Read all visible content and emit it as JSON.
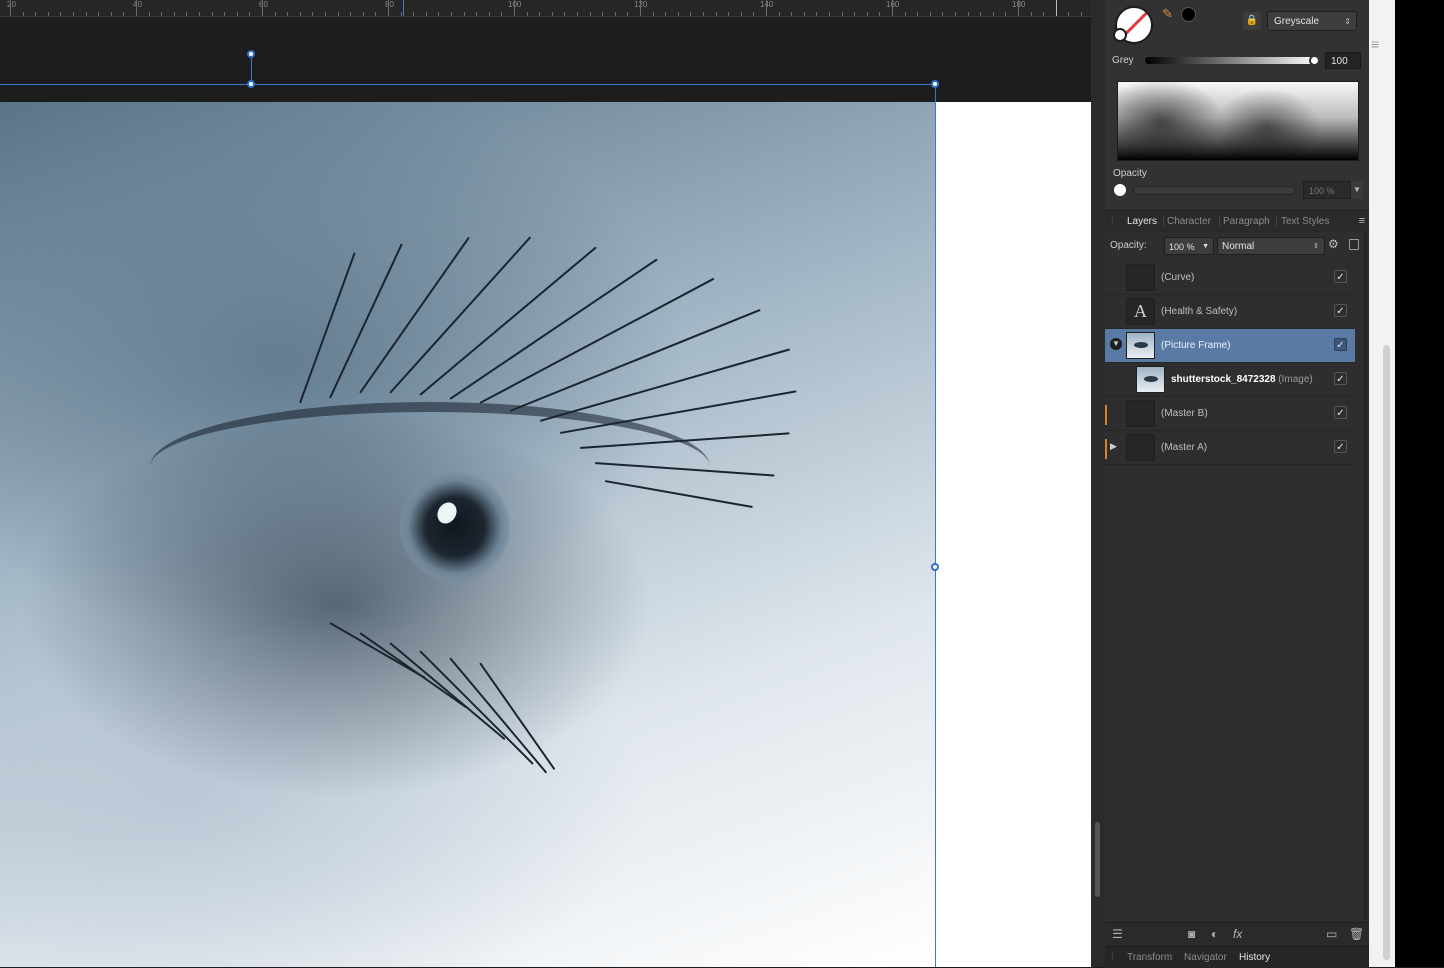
{
  "ruler": {
    "labels": [
      "20",
      "40",
      "60",
      "80",
      "100",
      "120",
      "140",
      "160",
      "180"
    ]
  },
  "color_panel": {
    "mode": "Greyscale",
    "grey_label": "Grey",
    "grey_value": "100",
    "opacity_label": "Opacity",
    "opacity_value": "100 %"
  },
  "tabs": {
    "layers": "Layers",
    "character": "Character",
    "paragraph": "Paragraph",
    "text_styles": "Text Styles"
  },
  "layer_options": {
    "opacity_label": "Opacity:",
    "opacity_value": "100 %",
    "blend_mode": "Normal"
  },
  "layers": [
    {
      "name": "(Curve)",
      "checked": true
    },
    {
      "name": "(Health & Safety)",
      "checked": true,
      "thumb_letter": "A"
    },
    {
      "name": "(Picture Frame)",
      "checked": true,
      "selected": true
    },
    {
      "name": "shutterstock_8472328",
      "suffix": "(Image)",
      "checked": true
    },
    {
      "name": "(Master B)",
      "checked": true
    },
    {
      "name": "(Master A)",
      "checked": true
    }
  ],
  "bottom_tabs": {
    "transform": "Transform",
    "navigator": "Navigator",
    "history": "History"
  },
  "icons": {
    "fx": "fx",
    "check": "✓"
  },
  "colors": {
    "selection": "#3b78c8",
    "layer_selected": "#5a7aa6",
    "master_accent": "#d8822f"
  }
}
